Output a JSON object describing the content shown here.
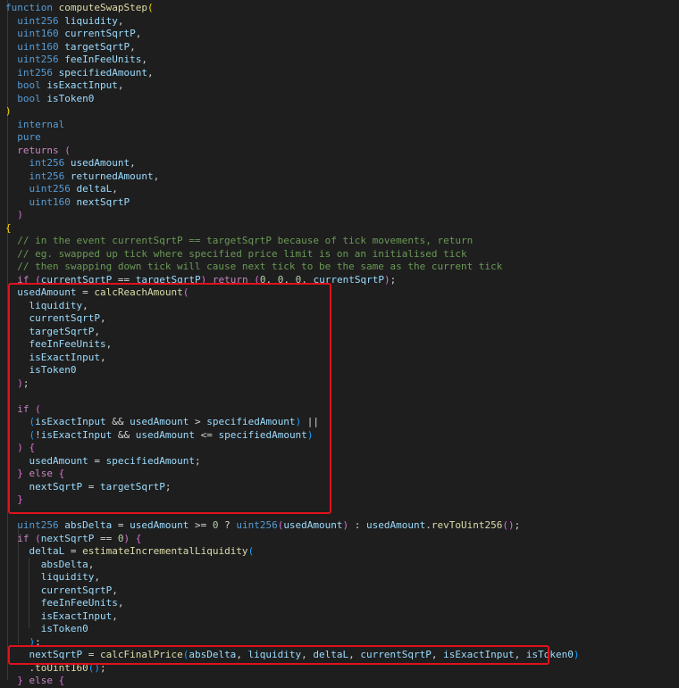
{
  "colors": {
    "keyword": "#569cd6",
    "control": "#c586c0",
    "type": "#4ec9b0",
    "func": "#dcdcaa",
    "var": "#9cdcfe",
    "plain": "#d4d4d4",
    "comment": "#6a9955",
    "number": "#b5cea8",
    "bracket1": "#ffd700",
    "bracket2": "#da70d6",
    "bracket3": "#179fff",
    "highlight": "#e0121d"
  },
  "code": {
    "lines": [
      {
        "tokens": [
          {
            "t": "function",
            "c": "keyword"
          },
          {
            "t": " "
          },
          {
            "t": "computeSwapStep",
            "c": "func"
          },
          {
            "t": "(",
            "c": "bracket1"
          }
        ]
      },
      {
        "tokens": [
          {
            "t": "  "
          },
          {
            "t": "uint256",
            "c": "keyword"
          },
          {
            "t": " "
          },
          {
            "t": "liquidity",
            "c": "var"
          },
          {
            "t": ","
          }
        ]
      },
      {
        "tokens": [
          {
            "t": "  "
          },
          {
            "t": "uint160",
            "c": "keyword"
          },
          {
            "t": " "
          },
          {
            "t": "currentSqrtP",
            "c": "var"
          },
          {
            "t": ","
          }
        ]
      },
      {
        "tokens": [
          {
            "t": "  "
          },
          {
            "t": "uint160",
            "c": "keyword"
          },
          {
            "t": " "
          },
          {
            "t": "targetSqrtP",
            "c": "var"
          },
          {
            "t": ","
          }
        ]
      },
      {
        "tokens": [
          {
            "t": "  "
          },
          {
            "t": "uint256",
            "c": "keyword"
          },
          {
            "t": " "
          },
          {
            "t": "feeInFeeUnits",
            "c": "var"
          },
          {
            "t": ","
          }
        ]
      },
      {
        "tokens": [
          {
            "t": "  "
          },
          {
            "t": "int256",
            "c": "keyword"
          },
          {
            "t": " "
          },
          {
            "t": "specifiedAmount",
            "c": "var"
          },
          {
            "t": ","
          }
        ]
      },
      {
        "tokens": [
          {
            "t": "  "
          },
          {
            "t": "bool",
            "c": "keyword"
          },
          {
            "t": " "
          },
          {
            "t": "isExactInput",
            "c": "var"
          },
          {
            "t": ","
          }
        ]
      },
      {
        "tokens": [
          {
            "t": "  "
          },
          {
            "t": "bool",
            "c": "keyword"
          },
          {
            "t": " "
          },
          {
            "t": "isToken0",
            "c": "var"
          }
        ]
      },
      {
        "tokens": [
          {
            "t": ")",
            "c": "bracket1"
          }
        ]
      },
      {
        "tokens": [
          {
            "t": "  "
          },
          {
            "t": "internal",
            "c": "keyword"
          }
        ]
      },
      {
        "tokens": [
          {
            "t": "  "
          },
          {
            "t": "pure",
            "c": "keyword"
          }
        ]
      },
      {
        "tokens": [
          {
            "t": "  "
          },
          {
            "t": "returns",
            "c": "control"
          },
          {
            "t": " "
          },
          {
            "t": "(",
            "c": "bracket2"
          }
        ]
      },
      {
        "tokens": [
          {
            "t": "    "
          },
          {
            "t": "int256",
            "c": "keyword"
          },
          {
            "t": " "
          },
          {
            "t": "usedAmount",
            "c": "var"
          },
          {
            "t": ","
          }
        ]
      },
      {
        "tokens": [
          {
            "t": "    "
          },
          {
            "t": "int256",
            "c": "keyword"
          },
          {
            "t": " "
          },
          {
            "t": "returnedAmount",
            "c": "var"
          },
          {
            "t": ","
          }
        ]
      },
      {
        "tokens": [
          {
            "t": "    "
          },
          {
            "t": "uint256",
            "c": "keyword"
          },
          {
            "t": " "
          },
          {
            "t": "deltaL",
            "c": "var"
          },
          {
            "t": ","
          }
        ]
      },
      {
        "tokens": [
          {
            "t": "    "
          },
          {
            "t": "uint160",
            "c": "keyword"
          },
          {
            "t": " "
          },
          {
            "t": "nextSqrtP",
            "c": "var"
          }
        ]
      },
      {
        "tokens": [
          {
            "t": "  "
          },
          {
            "t": ")",
            "c": "bracket2"
          }
        ]
      },
      {
        "tokens": [
          {
            "t": "{",
            "c": "bracket1"
          }
        ]
      },
      {
        "tokens": [
          {
            "t": "  "
          },
          {
            "t": "// in the event currentSqrtP == targetSqrtP because of tick movements, return",
            "c": "comment"
          }
        ]
      },
      {
        "tokens": [
          {
            "t": "  "
          },
          {
            "t": "// eg. swapped up tick where specified price limit is on an initialised tick",
            "c": "comment"
          }
        ]
      },
      {
        "tokens": [
          {
            "t": "  "
          },
          {
            "t": "// then swapping down tick will cause next tick to be the same as the current tick",
            "c": "comment"
          }
        ]
      },
      {
        "tokens": [
          {
            "t": "  "
          },
          {
            "t": "if",
            "c": "control"
          },
          {
            "t": " "
          },
          {
            "t": "(",
            "c": "bracket2"
          },
          {
            "t": "currentSqrtP",
            "c": "var"
          },
          {
            "t": " == "
          },
          {
            "t": "targetSqrtP",
            "c": "var"
          },
          {
            "t": ")",
            "c": "bracket2"
          },
          {
            "t": " "
          },
          {
            "t": "return",
            "c": "control"
          },
          {
            "t": " "
          },
          {
            "t": "(",
            "c": "bracket2"
          },
          {
            "t": "0",
            "c": "number"
          },
          {
            "t": ", "
          },
          {
            "t": "0",
            "c": "number"
          },
          {
            "t": ", "
          },
          {
            "t": "0",
            "c": "number"
          },
          {
            "t": ", "
          },
          {
            "t": "currentSqrtP",
            "c": "var"
          },
          {
            "t": ")",
            "c": "bracket2"
          },
          {
            "t": ";"
          }
        ]
      },
      {
        "tokens": [
          {
            "t": "  "
          },
          {
            "t": "usedAmount",
            "c": "var"
          },
          {
            "t": " = "
          },
          {
            "t": "calcReachAmount",
            "c": "func"
          },
          {
            "t": "(",
            "c": "bracket2"
          }
        ]
      },
      {
        "tokens": [
          {
            "t": "    "
          },
          {
            "t": "liquidity",
            "c": "var"
          },
          {
            "t": ","
          }
        ]
      },
      {
        "tokens": [
          {
            "t": "    "
          },
          {
            "t": "currentSqrtP",
            "c": "var"
          },
          {
            "t": ","
          }
        ]
      },
      {
        "tokens": [
          {
            "t": "    "
          },
          {
            "t": "targetSqrtP",
            "c": "var"
          },
          {
            "t": ","
          }
        ]
      },
      {
        "tokens": [
          {
            "t": "    "
          },
          {
            "t": "feeInFeeUnits",
            "c": "var"
          },
          {
            "t": ","
          }
        ]
      },
      {
        "tokens": [
          {
            "t": "    "
          },
          {
            "t": "isExactInput",
            "c": "var"
          },
          {
            "t": ","
          }
        ]
      },
      {
        "tokens": [
          {
            "t": "    "
          },
          {
            "t": "isToken0",
            "c": "var"
          }
        ]
      },
      {
        "tokens": [
          {
            "t": "  "
          },
          {
            "t": ")",
            "c": "bracket2"
          },
          {
            "t": ";"
          }
        ]
      },
      {
        "tokens": []
      },
      {
        "tokens": [
          {
            "t": "  "
          },
          {
            "t": "if",
            "c": "control"
          },
          {
            "t": " "
          },
          {
            "t": "(",
            "c": "bracket2"
          }
        ]
      },
      {
        "tokens": [
          {
            "t": "    "
          },
          {
            "t": "(",
            "c": "bracket3"
          },
          {
            "t": "isExactInput",
            "c": "var"
          },
          {
            "t": " && "
          },
          {
            "t": "usedAmount",
            "c": "var"
          },
          {
            "t": " > "
          },
          {
            "t": "specifiedAmount",
            "c": "var"
          },
          {
            "t": ")",
            "c": "bracket3"
          },
          {
            "t": " ||"
          }
        ]
      },
      {
        "tokens": [
          {
            "t": "    "
          },
          {
            "t": "(",
            "c": "bracket3"
          },
          {
            "t": "!"
          },
          {
            "t": "isExactInput",
            "c": "var"
          },
          {
            "t": " && "
          },
          {
            "t": "usedAmount",
            "c": "var"
          },
          {
            "t": " <= "
          },
          {
            "t": "specifiedAmount",
            "c": "var"
          },
          {
            "t": ")",
            "c": "bracket3"
          }
        ]
      },
      {
        "tokens": [
          {
            "t": "  "
          },
          {
            "t": ")",
            "c": "bracket2"
          },
          {
            "t": " "
          },
          {
            "t": "{",
            "c": "bracket2"
          }
        ]
      },
      {
        "tokens": [
          {
            "t": "    "
          },
          {
            "t": "usedAmount",
            "c": "var"
          },
          {
            "t": " = "
          },
          {
            "t": "specifiedAmount",
            "c": "var"
          },
          {
            "t": ";"
          }
        ]
      },
      {
        "tokens": [
          {
            "t": "  "
          },
          {
            "t": "}",
            "c": "bracket2"
          },
          {
            "t": " "
          },
          {
            "t": "else",
            "c": "control"
          },
          {
            "t": " "
          },
          {
            "t": "{",
            "c": "bracket2"
          }
        ]
      },
      {
        "tokens": [
          {
            "t": "    "
          },
          {
            "t": "nextSqrtP",
            "c": "var"
          },
          {
            "t": " = "
          },
          {
            "t": "targetSqrtP",
            "c": "var"
          },
          {
            "t": ";"
          }
        ]
      },
      {
        "tokens": [
          {
            "t": "  "
          },
          {
            "t": "}",
            "c": "bracket2"
          }
        ]
      },
      {
        "tokens": []
      },
      {
        "tokens": [
          {
            "t": "  "
          },
          {
            "t": "uint256",
            "c": "keyword"
          },
          {
            "t": " "
          },
          {
            "t": "absDelta",
            "c": "var"
          },
          {
            "t": " = "
          },
          {
            "t": "usedAmount",
            "c": "var"
          },
          {
            "t": " >= "
          },
          {
            "t": "0",
            "c": "number"
          },
          {
            "t": " ? "
          },
          {
            "t": "uint256",
            "c": "keyword"
          },
          {
            "t": "(",
            "c": "bracket2"
          },
          {
            "t": "usedAmount",
            "c": "var"
          },
          {
            "t": ")",
            "c": "bracket2"
          },
          {
            "t": " : "
          },
          {
            "t": "usedAmount",
            "c": "var"
          },
          {
            "t": "."
          },
          {
            "t": "revToUint256",
            "c": "func"
          },
          {
            "t": "()",
            "c": "bracket2"
          },
          {
            "t": ";"
          }
        ]
      },
      {
        "tokens": [
          {
            "t": "  "
          },
          {
            "t": "if",
            "c": "control"
          },
          {
            "t": " "
          },
          {
            "t": "(",
            "c": "bracket2"
          },
          {
            "t": "nextSqrtP",
            "c": "var"
          },
          {
            "t": " == "
          },
          {
            "t": "0",
            "c": "number"
          },
          {
            "t": ")",
            "c": "bracket2"
          },
          {
            "t": " "
          },
          {
            "t": "{",
            "c": "bracket2"
          }
        ]
      },
      {
        "tokens": [
          {
            "t": "    "
          },
          {
            "t": "deltaL",
            "c": "var"
          },
          {
            "t": " = "
          },
          {
            "t": "estimateIncrementalLiquidity",
            "c": "func"
          },
          {
            "t": "(",
            "c": "bracket3"
          }
        ]
      },
      {
        "tokens": [
          {
            "t": "      "
          },
          {
            "t": "absDelta",
            "c": "var"
          },
          {
            "t": ","
          }
        ]
      },
      {
        "tokens": [
          {
            "t": "      "
          },
          {
            "t": "liquidity",
            "c": "var"
          },
          {
            "t": ","
          }
        ]
      },
      {
        "tokens": [
          {
            "t": "      "
          },
          {
            "t": "currentSqrtP",
            "c": "var"
          },
          {
            "t": ","
          }
        ]
      },
      {
        "tokens": [
          {
            "t": "      "
          },
          {
            "t": "feeInFeeUnits",
            "c": "var"
          },
          {
            "t": ","
          }
        ]
      },
      {
        "tokens": [
          {
            "t": "      "
          },
          {
            "t": "isExactInput",
            "c": "var"
          },
          {
            "t": ","
          }
        ]
      },
      {
        "tokens": [
          {
            "t": "      "
          },
          {
            "t": "isToken0",
            "c": "var"
          }
        ]
      },
      {
        "tokens": [
          {
            "t": "    "
          },
          {
            "t": ")",
            "c": "bracket3"
          },
          {
            "t": ";"
          }
        ]
      },
      {
        "tokens": [
          {
            "t": "    "
          },
          {
            "t": "nextSqrtP",
            "c": "var"
          },
          {
            "t": " = "
          },
          {
            "t": "calcFinalPrice",
            "c": "func"
          },
          {
            "t": "(",
            "c": "bracket3"
          },
          {
            "t": "absDelta",
            "c": "var"
          },
          {
            "t": ", "
          },
          {
            "t": "liquidity",
            "c": "var"
          },
          {
            "t": ", "
          },
          {
            "t": "deltaL",
            "c": "var"
          },
          {
            "t": ", "
          },
          {
            "t": "currentSqrtP",
            "c": "var"
          },
          {
            "t": ", "
          },
          {
            "t": "isExactInput",
            "c": "var"
          },
          {
            "t": ", "
          },
          {
            "t": "isToken0",
            "c": "var"
          },
          {
            "t": ")",
            "c": "bracket3"
          }
        ]
      },
      {
        "tokens": [
          {
            "t": "    "
          },
          {
            "t": "."
          },
          {
            "t": "toUint160",
            "c": "func"
          },
          {
            "t": "()",
            "c": "bracket3"
          },
          {
            "t": ";"
          }
        ]
      },
      {
        "tokens": [
          {
            "t": "  "
          },
          {
            "t": "}",
            "c": "bracket2"
          },
          {
            "t": " "
          },
          {
            "t": "else",
            "c": "control"
          },
          {
            "t": " "
          },
          {
            "t": "{",
            "c": "bracket2"
          }
        ]
      }
    ]
  },
  "annotations": [
    {
      "label": "calcReachAmount block highlight"
    },
    {
      "label": "calcFinalPrice line highlight"
    }
  ]
}
